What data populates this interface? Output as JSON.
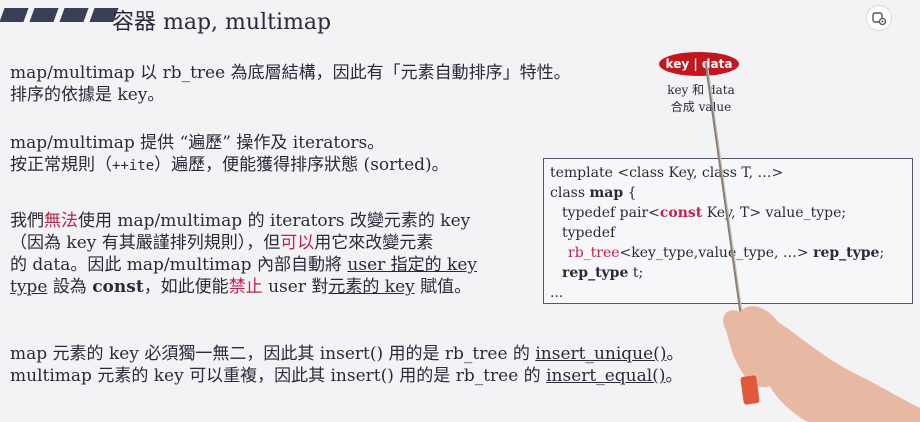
{
  "header": {
    "title": "容器 map, multimap",
    "tool_icon": "pen-settings-icon"
  },
  "paragraphs": {
    "p1": {
      "line1": "map/multimap 以 rb_tree 為底層結構，因此有「元素自動排序」特性。",
      "line2": "排序的依據是 key。"
    },
    "p2": {
      "line1": "map/multimap 提供 “遍歷” 操作及 iterators。",
      "line2_a": "按正常規則（",
      "line2_code": "++ite",
      "line2_b": "）遍歷，便能獲得排序狀態 (sorted)。"
    },
    "p3": {
      "l1_a": "我們",
      "l1_red": "無法",
      "l1_b": "使用 map/multimap 的 iterators 改變元素的 key",
      "l2_a": "（因為 key 有其嚴謹排列規則），但",
      "l2_red": "可以",
      "l2_b": "用它來改變元素",
      "l3_a": "的 data。因此 map/multimap 內部自動將 ",
      "l3_u": "user 指定的 key",
      "l4_u": "type",
      "l4_a": " 設為 ",
      "l4_b": "const",
      "l4_c": "，如此便能",
      "l4_red": "禁止",
      "l4_d": " user 對",
      "l4_u2": "元素的 key",
      "l4_e": " 賦值。"
    },
    "p4": {
      "l1_a": "map 元素的 key 必須獨一無二，因此其 insert() 用的是 rb_tree 的 ",
      "l1_u": "insert_unique()",
      "l1_b": "。",
      "l2_a": "multimap 元素的 key 可以重複，因此其 insert() 用的是 rb_tree 的 ",
      "l2_u": "insert_equal()",
      "l2_b": "。"
    }
  },
  "badge": {
    "label": "key | data",
    "caption1": "key 和 data",
    "caption2": "合成 value"
  },
  "code": {
    "l1": "template <class Key, class T, …>",
    "l2_a": "class ",
    "l2_b": "map",
    "l2_c": " {",
    "l3_a": "typedef pair<",
    "l3_red": "const",
    "l3_b": " Key, T> value_type;",
    "l4": "typedef",
    "l5_red": "rb_tree",
    "l5_a": "<key_type,value_type, …> ",
    "l5_b": "rep_type",
    "l5_c": ";",
    "l6_b": "rep_type",
    "l6_a": " t;",
    "l7": "..."
  },
  "colors": {
    "accent_red": "#c0224a",
    "badge_red": "#c3171f",
    "header_bar": "#3a3f55"
  }
}
